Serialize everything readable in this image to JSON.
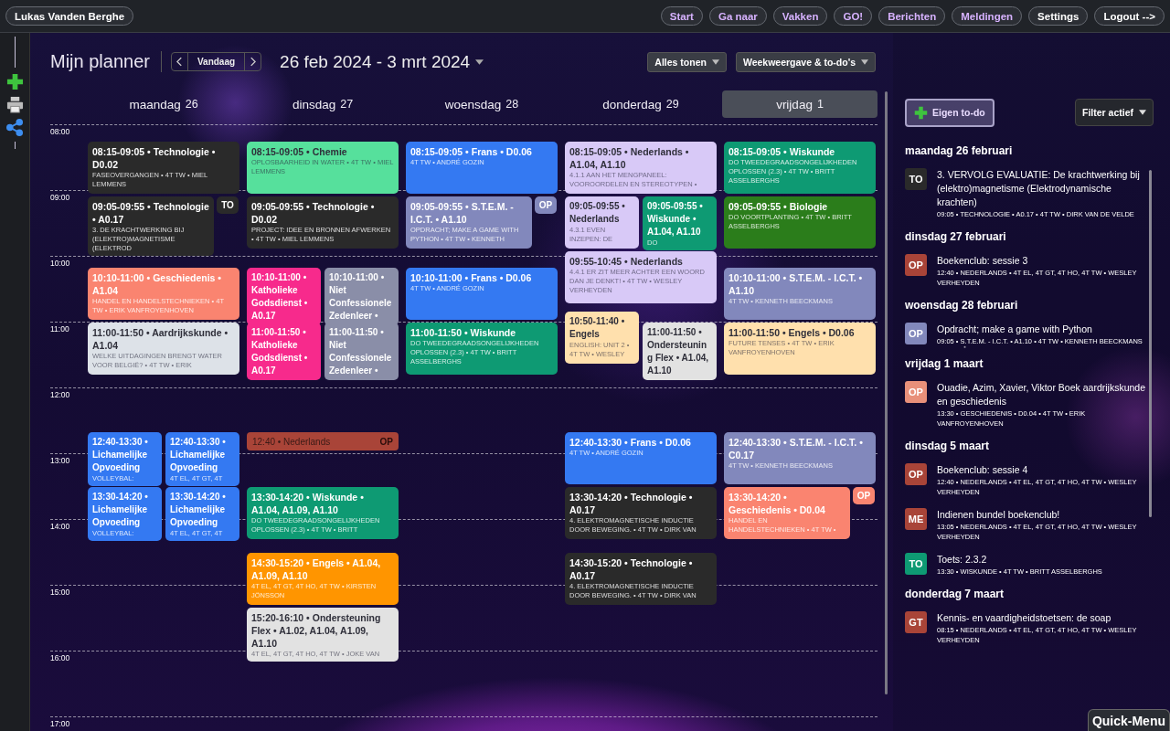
{
  "topbar": {
    "user": "Lukas Vanden Berghe",
    "nav": [
      {
        "label": "Start",
        "kind": "page"
      },
      {
        "label": "Ga naar",
        "kind": "page"
      },
      {
        "label": "Vakken",
        "kind": "page"
      },
      {
        "label": "GO!",
        "kind": "page"
      },
      {
        "label": "Berichten",
        "kind": "page"
      },
      {
        "label": "Meldingen",
        "kind": "page"
      },
      {
        "label": "Settings",
        "kind": "account"
      },
      {
        "label": "Logout -->",
        "kind": "account"
      }
    ]
  },
  "planner": {
    "title": "Mijn planner",
    "today_button": "Vandaag",
    "range": "26 feb 2024 - 3 mrt 2024",
    "filters": [
      "Alles tonen",
      "Weekweergave & to-do's"
    ]
  },
  "days": [
    {
      "name": "maandag",
      "num": "26",
      "selected": false,
      "slots": [
        [
          {
            "title": "08:15-09:05 • Technologie • D0.02",
            "sub": "FASEOVERGANGEN • 4T TW • MIEL LEMMENS",
            "color": "#2a2a2a"
          }
        ],
        [
          {
            "title": "09:05-09:55 • Technologie • A0.17",
            "sub": "3. DE KRACHTWERKING BIJ (ELEKTRO)MAGNETISME (ELEKTROD",
            "color": "#2a2a2a",
            "badge": "TO"
          }
        ],
        [
          {
            "title": "10:10-11:00 • Geschiedenis • A1.04",
            "sub": "HANDEL EN HANDELSTECHNIEKEN • 4T TW • ERIK VANFROYENHOVEN",
            "color": "#fa8470"
          }
        ],
        [
          {
            "title": "11:00-11:50 • Aardrijkskunde • A1.04",
            "sub": "WELKE UITDAGINGEN BRENGT WATER VOOR BELGIË? • 4T TW • ERIK",
            "color": "#dde2e8"
          }
        ],
        [
          {
            "title": "12:40-13:30 • Lichamelijke Opvoeding",
            "sub": "VOLLEYBAL:",
            "color": "#3479f2"
          },
          {
            "title": "12:40-13:30 • Lichamelijke Opvoeding",
            "sub": "4T EL, 4T GT, 4T",
            "color": "#3479f2"
          }
        ],
        [
          {
            "title": "13:30-14:20 • Lichamelijke Opvoeding",
            "sub": "VOLLEYBAL:",
            "color": "#3479f2"
          },
          {
            "title": "13:30-14:20 • Lichamelijke Opvoeding",
            "sub": "4T EL, 4T GT, 4T",
            "color": "#3479f2"
          }
        ]
      ]
    },
    {
      "name": "dinsdag",
      "num": "27",
      "selected": false,
      "slots": [
        [
          {
            "title": "08:15-09:05 • Chemie",
            "sub": "OPLOSBAARHEID IN WATER • 4T TW • MIEL LEMMENS",
            "color": "#56e09c"
          }
        ],
        [
          {
            "title": "09:05-09:55 • Technologie • D0.02",
            "sub": "PROJECT: IDEE EN BRONNEN AFWERKEN • 4T TW • MIEL LEMMENS",
            "color": "#2a2a2a"
          }
        ],
        [
          {
            "title": "10:10-11:00 • Katholieke Godsdienst • A0.17",
            "color": "#f72a8c"
          },
          {
            "title": "10:10-11:00 • Niet Confessionele Zedenleer •",
            "color": "#8a8ea8"
          }
        ],
        [
          {
            "title": "11:00-11:50 • Katholieke Godsdienst • A0.17",
            "color": "#f72a8c"
          },
          {
            "title": "11:00-11:50 • Niet Confessionele Zedenleer •",
            "color": "#8a8ea8"
          }
        ],
        [
          {
            "kind": "todo",
            "title": "12:40 • Nederlands",
            "badge": "OP",
            "color": "#a94438"
          }
        ],
        [
          {
            "title": "13:30-14:20 • Wiskunde • A1.04, A1.09, A1.10",
            "sub": "DO TWEEDEGRAADSONGELIJKHEDEN OPLOSSEN (2.3) • 4T TW • BRITT",
            "color": "#0e9a73"
          }
        ],
        [
          {
            "title": "14:30-15:20 • Engels • A1.04, A1.09, A1.10",
            "sub": "4T EL, 4T GT, 4T HO, 4T TW • KIRSTEN JÖNSSON",
            "color": "#ff9500"
          }
        ],
        [
          {
            "title": "15:20-16:10 • Ondersteuning Flex • A1.02, A1.04, A1.09, A1.10",
            "sub": "4T EL, 4T GT, 4T HO, 4T TW • JOKE VAN",
            "color": "#e2e2e2"
          }
        ]
      ]
    },
    {
      "name": "woensdag",
      "num": "28",
      "selected": false,
      "slots": [
        [
          {
            "title": "08:15-09:05 • Frans • D0.06",
            "sub": "4T TW • ANDRÉ GOZIN",
            "color": "#3479f2"
          }
        ],
        [
          {
            "title": "09:05-09:55 • S.T.E.M. - I.C.T. • A1.10",
            "sub": "OPDRACHT; MAKE A GAME WITH PYTHON • 4T TW • KENNETH",
            "color": "#8288bc",
            "badge": "OP"
          }
        ],
        [
          {
            "title": "10:10-11:00 • Frans • D0.06",
            "sub": "4T TW • ANDRÉ GOZIN",
            "color": "#3479f2"
          }
        ],
        [
          {
            "title": "11:00-11:50 • Wiskunde",
            "sub": "DO TWEEDEGRAADSONGELIJKHEDEN OPLOSSEN (2.3) • 4T TW • BRITT ASSELBERGHS",
            "color": "#0e9a73"
          }
        ]
      ]
    },
    {
      "name": "donderdag",
      "num": "29",
      "selected": false,
      "slots": [
        [
          {
            "title": "08:15-09:05 • Nederlands • A1.04, A1.10",
            "sub": "4.1.1 AAN HET MENGPANEEL: VOOROORDELEN EN STEREOTYPEN •",
            "color": "#d8c9f7"
          }
        ],
        [
          {
            "title": "09:05-09:55 • Nederlands",
            "sub": "4.3.1 EVEN INZEPEN: DE",
            "color": "#d8c9f7"
          },
          {
            "title": "09:05-09:55 • Wiskunde • A1.04, A1.10",
            "sub": "DO",
            "color": "#0e9a73"
          }
        ],
        [
          {
            "title": "09:55-10:45 • Nederlands",
            "sub": "4.4.1 ER ZIT MEER ACHTER EEN WOORD DAN JE DENKT! • 4T TW • WESLEY VERHEYDEN",
            "color": "#d8c9f7"
          }
        ],
        [
          {
            "title": "10:50-11:40 • Engels",
            "sub": "ENGLISH: UNIT 2 • 4T TW • WESLEY",
            "color": "#ffe0ad"
          },
          {
            "title": "11:00-11:50 • Ondersteuning Flex • A1.04, A1.10",
            "color": "#e2e2e2"
          }
        ],
        [
          {
            "title": "12:40-13:30 • Frans • D0.06",
            "sub": "4T TW • ANDRÉ GOZIN",
            "color": "#3479f2"
          }
        ],
        [
          {
            "title": "13:30-14:20 • Technologie • A0.17",
            "sub": "4. ELEKTROMAGNETISCHE INDUCTIE DOOR BEWEGING. • 4T TW • DIRK VAN",
            "color": "#2a2a2a"
          }
        ],
        [
          {
            "title": "14:30-15:20 • Technologie • A0.17",
            "sub": "4. ELEKTROMAGNETISCHE INDUCTIE DOOR BEWEGING. • 4T TW • DIRK VAN",
            "color": "#2a2a2a"
          }
        ]
      ]
    },
    {
      "name": "vrijdag",
      "num": "1",
      "selected": true,
      "slots": [
        [
          {
            "title": "08:15-09:05 • Wiskunde",
            "sub": "DO TWEEDEGRAADSONGELIJKHEDEN OPLOSSEN (2.3) • 4T TW • BRITT ASSELBERGHS",
            "color": "#0e9a73"
          }
        ],
        [
          {
            "title": "09:05-09:55 • Biologie",
            "sub": "DO VOORTPLANTING • 4T TW • BRITT ASSELBERGHS",
            "color": "#2b7d1b"
          }
        ],
        [
          {
            "title": "10:10-11:00 • S.T.E.M. - I.C.T. • A1.10",
            "sub": "4T TW • KENNETH BEECKMANS",
            "color": "#8288bc"
          }
        ],
        [
          {
            "title": "11:00-11:50 • Engels • D0.06",
            "sub": "FUTURE TENSES • 4T TW • ERIK VANFROYENHOVEN",
            "color": "#ffe0ad"
          }
        ],
        [
          {
            "title": "12:40-13:30 • S.T.E.M. - I.C.T. • C0.17",
            "sub": "4T TW • KENNETH BEECKMANS",
            "color": "#8288bc"
          }
        ],
        [
          {
            "title": "13:30-14:20 • Geschiedenis • D0.04",
            "sub": "HANDEL EN HANDELSTECHNIEKEN • 4T TW •",
            "color": "#fa8470",
            "badge": "OP"
          }
        ]
      ]
    }
  ],
  "hours": [
    "08:00",
    "09:00",
    "10:00",
    "11:00",
    "12:00",
    "13:00",
    "14:00",
    "15:00",
    "16:00",
    "17:00"
  ],
  "todo": {
    "add_button": "Eigen to-do",
    "filter": "Filter actief",
    "groups": [
      {
        "date": "maandag 26 februari",
        "items": [
          {
            "badge": "TO",
            "color": "#2a2a2a",
            "title": "3. VERVOLG EVALUATIE: De krachtwerking bij (elektro)magnetisme (Elektrodynamische krachten)",
            "meta": "09:05 • TECHNOLOGIE • A0.17 • 4T TW • DIRK VAN DE VELDE"
          }
        ]
      },
      {
        "date": "dinsdag 27 februari",
        "items": [
          {
            "badge": "OP",
            "color": "#a94438",
            "title": "Boekenclub: sessie 3",
            "meta": "12:40 • NEDERLANDS • 4T EL, 4T GT, 4T HO, 4T TW • WESLEY VERHEYDEN"
          }
        ]
      },
      {
        "date": "woensdag 28 februari",
        "items": [
          {
            "badge": "OP",
            "color": "#8288bc",
            "title": "Opdracht; make a game with Python",
            "meta": "09:05 • S.T.E.M. - I.C.T. • A1.10 • 4T TW • KENNETH BEECKMANS"
          }
        ]
      },
      {
        "date": "vrijdag 1 maart",
        "items": [
          {
            "badge": "OP",
            "color": "#e8907a",
            "title": "Ouadie, Azim, Xavier, Viktor Boek aardrijkskunde en geschiedenis",
            "meta": "13:30 • GESCHIEDENIS • D0.04 • 4T TW • ERIK VANFROYENHOVEN"
          }
        ]
      },
      {
        "date": "dinsdag 5 maart",
        "items": [
          {
            "badge": "OP",
            "color": "#a94438",
            "title": "Boekenclub: sessie 4",
            "meta": "12:40 • NEDERLANDS • 4T EL, 4T GT, 4T HO, 4T TW • WESLEY VERHEYDEN"
          },
          {
            "badge": "ME",
            "color": "#a94438",
            "title": "Indienen bundel boekenclub!",
            "meta": "13:05 • NEDERLANDS • 4T EL, 4T GT, 4T HO, 4T TW • WESLEY VERHEYDEN"
          },
          {
            "badge": "TO",
            "color": "#0e9a73",
            "title": "Toets: 2.3.2",
            "meta": "13:30 • WISKUNDE • 4T TW • BRITT ASSELBERGHS"
          }
        ]
      },
      {
        "date": "donderdag 7 maart",
        "items": [
          {
            "badge": "GT",
            "color": "#a94438",
            "title": "Kennis- en vaardigheidstoetsen: de soap",
            "meta": "08:15 • NEDERLANDS • 4T EL, 4T GT, 4T HO, 4T TW • WESLEY VERHEYDEN"
          }
        ]
      }
    ]
  },
  "quick_menu": "Quick-Menu"
}
